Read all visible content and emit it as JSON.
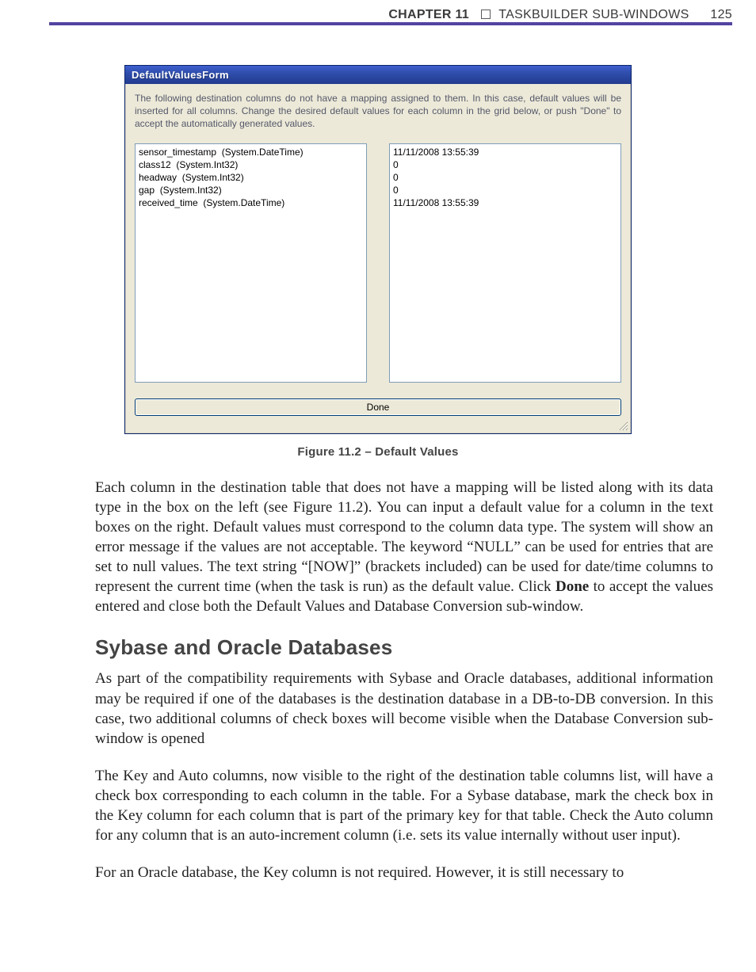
{
  "header": {
    "chapter_label": "CHAPTER 11",
    "title": "TASKBUILDER SUB-WINDOWS",
    "page_number": "125"
  },
  "dialog": {
    "title": "DefaultValuesForm",
    "message": "The following destination columns do not have a mapping assigned to them.  In this case, default values will be inserted for all columns.  Change the desired default values for each column in the grid below, or push \"Done\" to accept the automatically generated values.",
    "left_list": "sensor_timestamp  (System.DateTime)\nclass12  (System.Int32)\nheadway  (System.Int32)\ngap  (System.Int32)\nreceived_time  (System.DateTime)",
    "right_list": "11/11/2008 13:55:39\n0\n0\n0\n11/11/2008 13:55:39",
    "done_label": "Done"
  },
  "caption": "Figure 11.2 – Default Values",
  "para1_a": "Each column in the destination table that does not have a mapping will be listed along with its data type in the box on the left (see Figure 11.2). You can input a default value for a column in the text boxes on the right. Default values must correspond to the column data type. The system will show an error message if the values are not acceptable. The keyword “NULL” can be used for entries that are set to null values. The text string “[NOW]” (brackets included) can be used for date/time columns to represent the current time (when the task is run) as the default value. Click ",
  "para1_bold": "Done",
  "para1_b": " to accept the values entered and close both the Default Values and Database Conversion sub-window.",
  "h2": "Sybase and Oracle Databases",
  "para2": "As part of the compatibility requirements with Sybase and Oracle databases, additional information may be required if one of the databases is the destination database in a DB-to-DB conversion. In this case, two additional columns of check boxes will become visible when the Database Conversion sub-window is opened",
  "para3": "The Key and Auto columns, now visible to the right of the destination table columns list, will have a check box corresponding to each column in the table. For a Sybase database, mark the check box in the Key column for each column that is part of the primary key for that table. Check the Auto column for any column that is an auto-increment column (i.e. sets its value internally without user input).",
  "para4": "For an Oracle database, the Key column is not required. However, it is still necessary to"
}
